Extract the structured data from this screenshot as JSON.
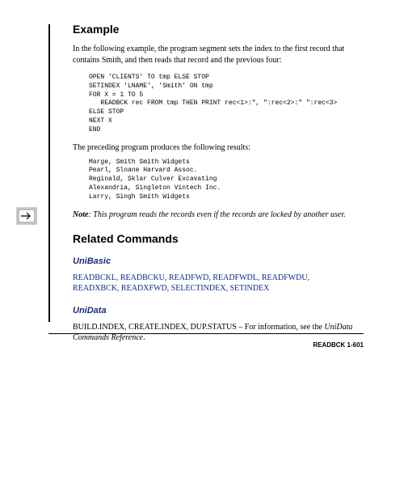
{
  "headings": {
    "example": "Example",
    "related": "Related Commands"
  },
  "example": {
    "intro": "In the following example, the program segment sets the index to the first record that contains Smith, and then reads that record and the previous four:",
    "code": "OPEN 'CLIENTS' TO tmp ELSE STOP\nSETINDEX 'LNAME', 'Smith' ON tmp\nFOR X = 1 TO 5\n   READBCK rec FROM tmp THEN PRINT rec<1>:\", \":rec<2>:\" \":rec<3>\nELSE STOP\nNEXT X\nEND",
    "results_intro": "The preceding program produces the following results:",
    "results": "Marge, Smith Smith Widgets\nPearl, Sloane Harvard Assoc.\nReginald, Sklar Culver Excavating\nAlexandria, Singleton Vintech Inc.\nLarry, Singh Smith Widgets"
  },
  "note": {
    "label": "Note",
    "text": ": This program reads the records even if the records are locked by another user."
  },
  "related": {
    "unibasic_label": "UniBasic",
    "unibasic_links_line1": "READBCKL, READBCKU, READFWD, READFWDL, READFWDU,",
    "unibasic_links_line2": "READXBCK, READXFWD, SELECTINDEX, SETINDEX",
    "unidata_label": "UniData",
    "unidata_text_plain": "BUILD.INDEX, CREATE.INDEX, DUP.STATUS – For information, see the ",
    "unidata_text_ital": "UniData Commands Reference",
    "unidata_text_end": "."
  },
  "footer": "READBCK  1-601"
}
